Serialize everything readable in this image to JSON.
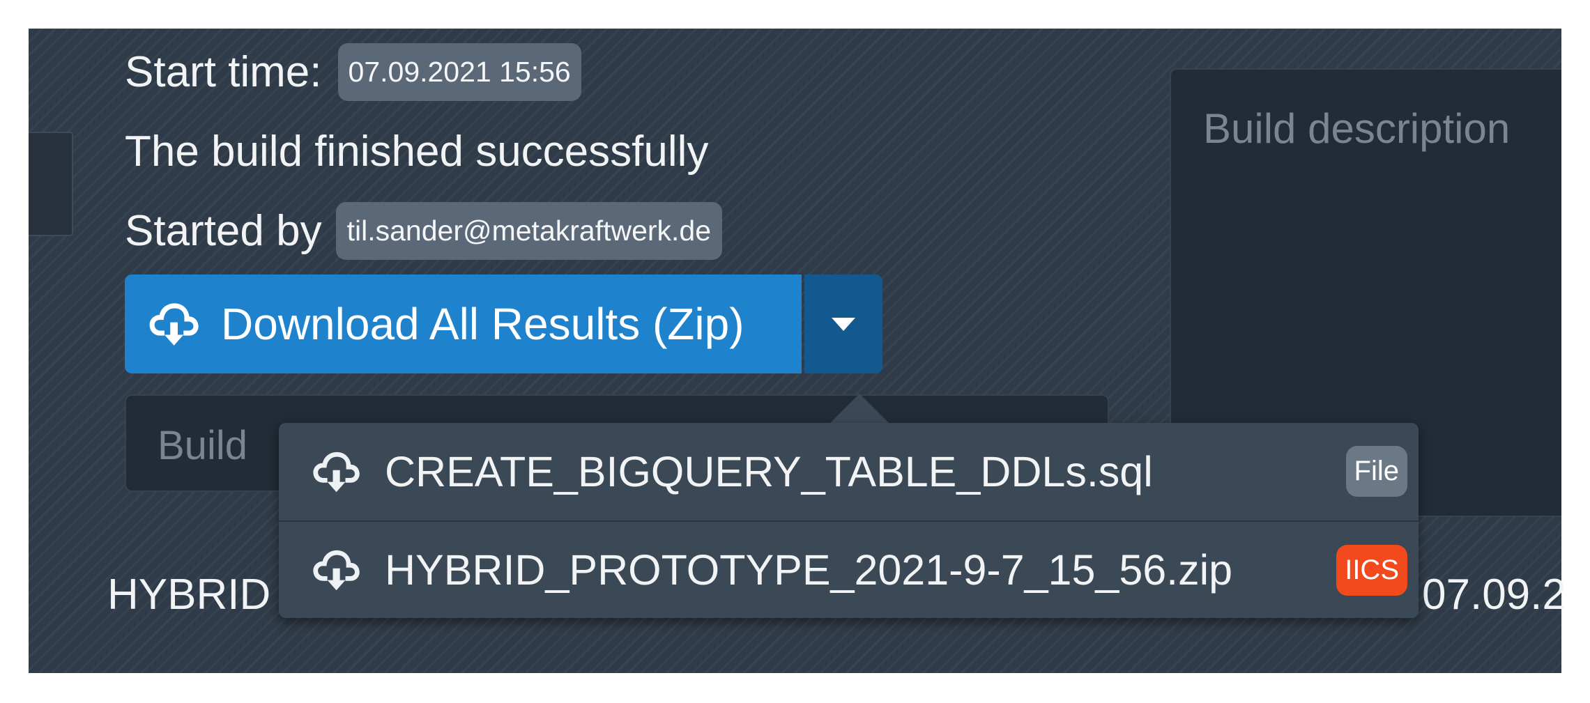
{
  "build": {
    "start_time_label": "Start time:",
    "start_time_value": "07.09.2021 15:56",
    "status_text": "The build finished successfully",
    "started_by_label": "Started by",
    "started_by_value": "til.sander@metakraftwerk.de",
    "download_button_label": "Download All Results (Zip)",
    "build_field_placeholder": "Build",
    "description_placeholder": "Build description"
  },
  "dropdown": {
    "items": [
      {
        "name": "CREATE_BIGQUERY_TABLE_DDLs.sql",
        "badge": "File",
        "badge_color": "#6b7886",
        "icon": "cloud-download-icon"
      },
      {
        "name": "HYBRID_PROTOTYPE_2021-9-7_15_56.zip",
        "badge": "IICS",
        "badge_color": "#f24a1d",
        "icon": "cloud-download-icon"
      }
    ]
  },
  "background_row": {
    "left_text": "HYBRID",
    "right_text": "07.09.2"
  },
  "colors": {
    "panel_bg": "#2f3b48",
    "button_primary": "#1e82cd",
    "button_caret": "#12598f",
    "chip_bg": "#5b6877",
    "dropdown_bg": "#3b4855"
  }
}
